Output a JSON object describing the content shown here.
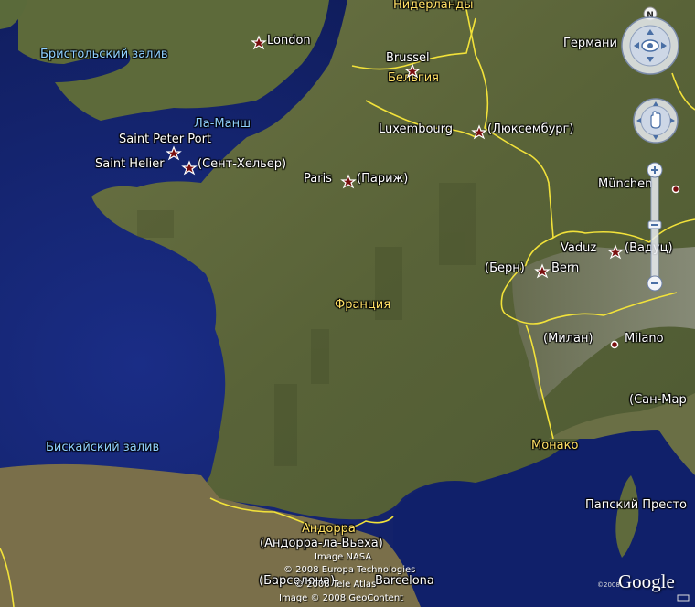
{
  "map": {
    "cities": [
      {
        "id": "london",
        "name": "London"
      },
      {
        "id": "brussel",
        "name": "Brussel"
      },
      {
        "id": "luxembourg",
        "name": "Luxembourg",
        "alt": "(Люксембург)"
      },
      {
        "id": "saint-peter-port",
        "name": "Saint Peter Port"
      },
      {
        "id": "saint-helier",
        "name": "Saint Helier",
        "alt": "(Сент-Хельер)"
      },
      {
        "id": "paris",
        "name": "Paris",
        "alt": "(Париж)"
      },
      {
        "id": "munchen",
        "name": "München"
      },
      {
        "id": "vaduz",
        "name": "Vaduz",
        "alt": "(Вадуц)"
      },
      {
        "id": "bern",
        "name": "Bern",
        "alt": "(Берн)"
      },
      {
        "id": "milano",
        "name": "Milano",
        "alt": "(Милан)"
      },
      {
        "id": "san-marino",
        "alt": "(Сан-Мар"
      },
      {
        "id": "andorra",
        "name": "(Андорра-ла-Вьеха)"
      },
      {
        "id": "barcelona",
        "name": "Barcelona",
        "alt": "(Барселона)"
      }
    ],
    "countries": {
      "netherlands": "Нидерланды",
      "germany": "Германи",
      "belgium": "Бельгия",
      "france": "Франция",
      "monaco": "Монако",
      "andorra": "Андорра"
    },
    "water": {
      "bristol": "Бристольский залив",
      "la_manche": "Ла-Манш",
      "biscay": "Бискайский залив",
      "papal": "Папский Престо"
    }
  },
  "attribution": {
    "line1": "Image NASA",
    "line2": "© 2008 Europa Technologies",
    "line3": "© 2008 Tele Atlas",
    "line4": "Image © 2008 GeoContent",
    "logo": "Google",
    "small": "©2008"
  },
  "controls": {
    "compass_north": "N"
  },
  "colors": {
    "ocean": "#14246e",
    "land": "#5a6638",
    "border": "#f2e23a",
    "star": "#7a1010"
  }
}
